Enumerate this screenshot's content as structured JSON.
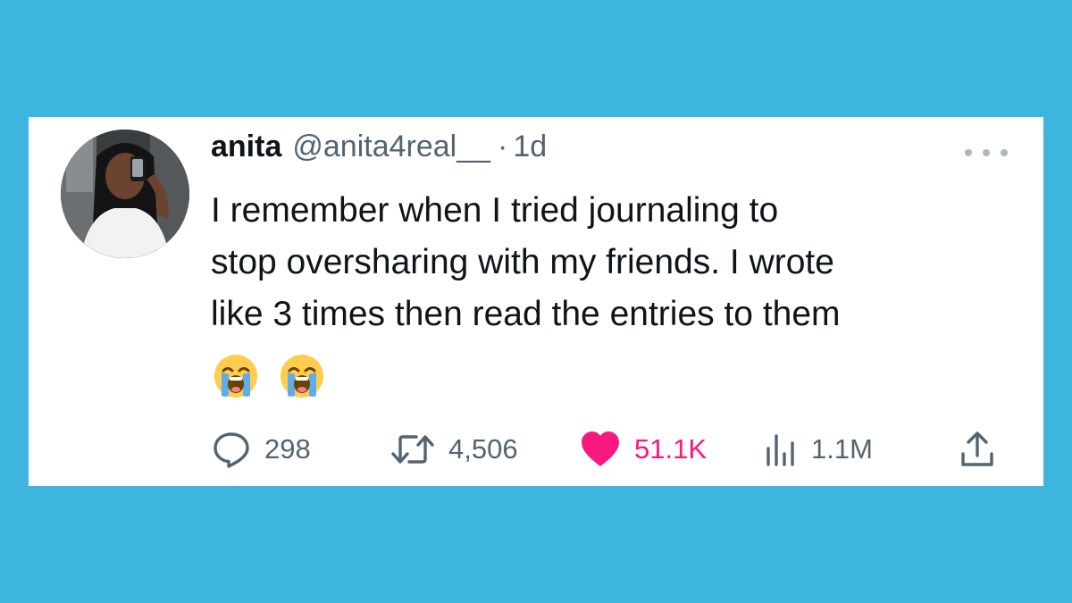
{
  "tweet": {
    "author_name": "anita",
    "author_handle": "@anita4real__",
    "separator": "·",
    "time": "1d",
    "text_lines": [
      "I remember when I tried journaling to",
      "stop oversharing with my friends. I wrote",
      "like 3 times then read the entries to them"
    ],
    "emojis": [
      "loudly-crying-face",
      "loudly-crying-face"
    ]
  },
  "actions": {
    "replies": "298",
    "retweets": "4,506",
    "likes": "51.1K",
    "views": "1.1M"
  },
  "icons": {
    "reply": "speech-bubble-icon",
    "retweet": "retweet-icon",
    "like": "heart-icon",
    "views": "bar-chart-icon",
    "share": "share-icon",
    "more": "more-dots-icon"
  },
  "colors": {
    "background": "#3db5df",
    "card": "#ffffff",
    "text": "#0f1419",
    "secondary": "#536471",
    "like": "#f91880"
  }
}
